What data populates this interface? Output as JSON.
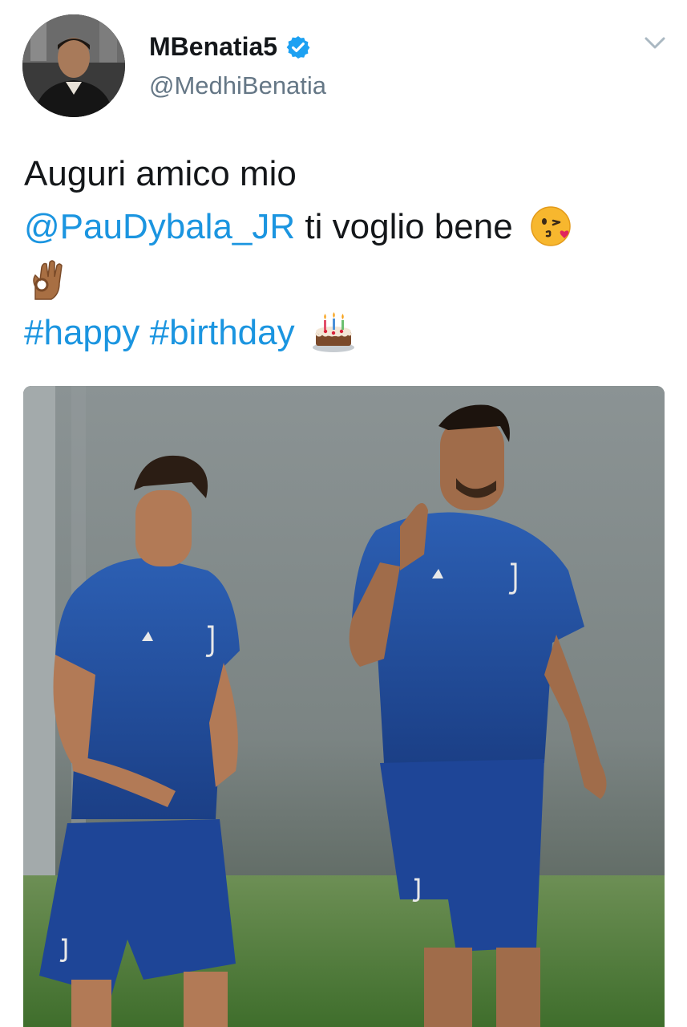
{
  "tweet": {
    "author": {
      "display_name": "MBenatia5",
      "handle": "@MedhiBenatia",
      "verified": true,
      "avatar_icon": "user-avatar-photo"
    },
    "menu_icon": "chevron-down-icon",
    "text": {
      "line1": "Auguri amico mio",
      "mention": "@PauDybala_JR",
      "line2_rest": " ti voglio bene",
      "hashtag1": "#happy",
      "hashtag2": "#birthday"
    },
    "emojis": [
      "kissing-face-emoji",
      "ok-hand-emoji",
      "birthday-cake-emoji"
    ],
    "media": {
      "type": "photo",
      "icon": "tweet-photo"
    }
  },
  "colors": {
    "link": "#1b95e0",
    "text": "#14171a",
    "secondary": "#657786",
    "verified": "#1da1f2"
  }
}
